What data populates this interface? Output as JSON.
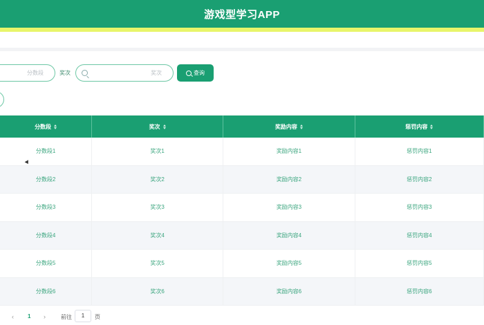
{
  "header": {
    "title": "游戏型学习APP"
  },
  "search": {
    "score_placeholder": "分数段",
    "rank_label": "奖次",
    "rank_placeholder": "奖次",
    "query_label": "查询"
  },
  "table": {
    "columns": [
      "分数段",
      "奖次",
      "奖励内容",
      "惩罚内容"
    ],
    "rows": [
      [
        "分数段1",
        "奖次1",
        "奖励内容1",
        "惩罚内容1"
      ],
      [
        "分数段2",
        "奖次2",
        "奖励内容2",
        "惩罚内容2"
      ],
      [
        "分数段3",
        "奖次3",
        "奖励内容3",
        "惩罚内容3"
      ],
      [
        "分数段4",
        "奖次4",
        "奖励内容4",
        "惩罚内容4"
      ],
      [
        "分数段5",
        "奖次5",
        "奖励内容5",
        "惩罚内容5"
      ],
      [
        "分数段6",
        "奖次6",
        "奖励内容6",
        "惩罚内容6"
      ]
    ]
  },
  "pagination": {
    "prev": "‹",
    "current_page": "1",
    "next": "›",
    "goto_label": "前往",
    "goto_value": "1",
    "unit": "页"
  },
  "colors": {
    "primary": "#1a9f72",
    "stripe": "#e8f56a",
    "text": "#3aa57e"
  }
}
